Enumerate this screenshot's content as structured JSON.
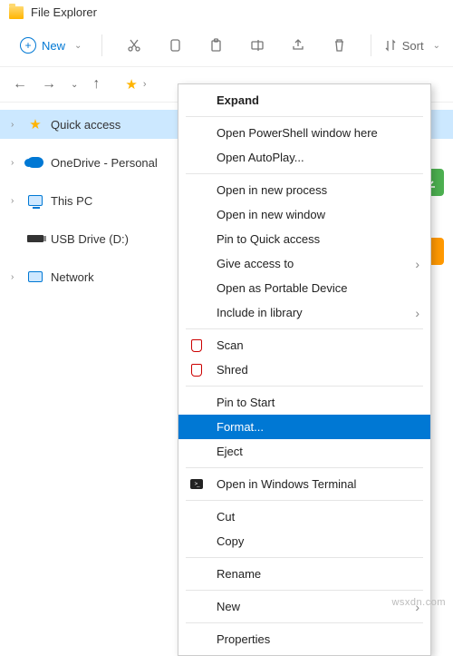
{
  "title": "File Explorer",
  "toolbar": {
    "newLabel": "New",
    "sortLabel": "Sort"
  },
  "tree": {
    "items": [
      {
        "label": "Quick access"
      },
      {
        "label": "OneDrive - Personal"
      },
      {
        "label": "This PC"
      },
      {
        "label": "USB Drive (D:)"
      },
      {
        "label": "Network"
      }
    ]
  },
  "menu": {
    "expand": "Expand",
    "openPS": "Open PowerShell window here",
    "openAuto": "Open AutoPlay...",
    "openProc": "Open in new process",
    "openWin": "Open in new window",
    "pinQA": "Pin to Quick access",
    "giveAccess": "Give access to",
    "openPortable": "Open as Portable Device",
    "includeLib": "Include in library",
    "scan": "Scan",
    "shred": "Shred",
    "pinStart": "Pin to Start",
    "format": "Format...",
    "eject": "Eject",
    "openTerm": "Open in Windows Terminal",
    "cut": "Cut",
    "copy": "Copy",
    "rename": "Rename",
    "newItem": "New",
    "properties": "Properties"
  },
  "watermark": "wsxdn.com"
}
